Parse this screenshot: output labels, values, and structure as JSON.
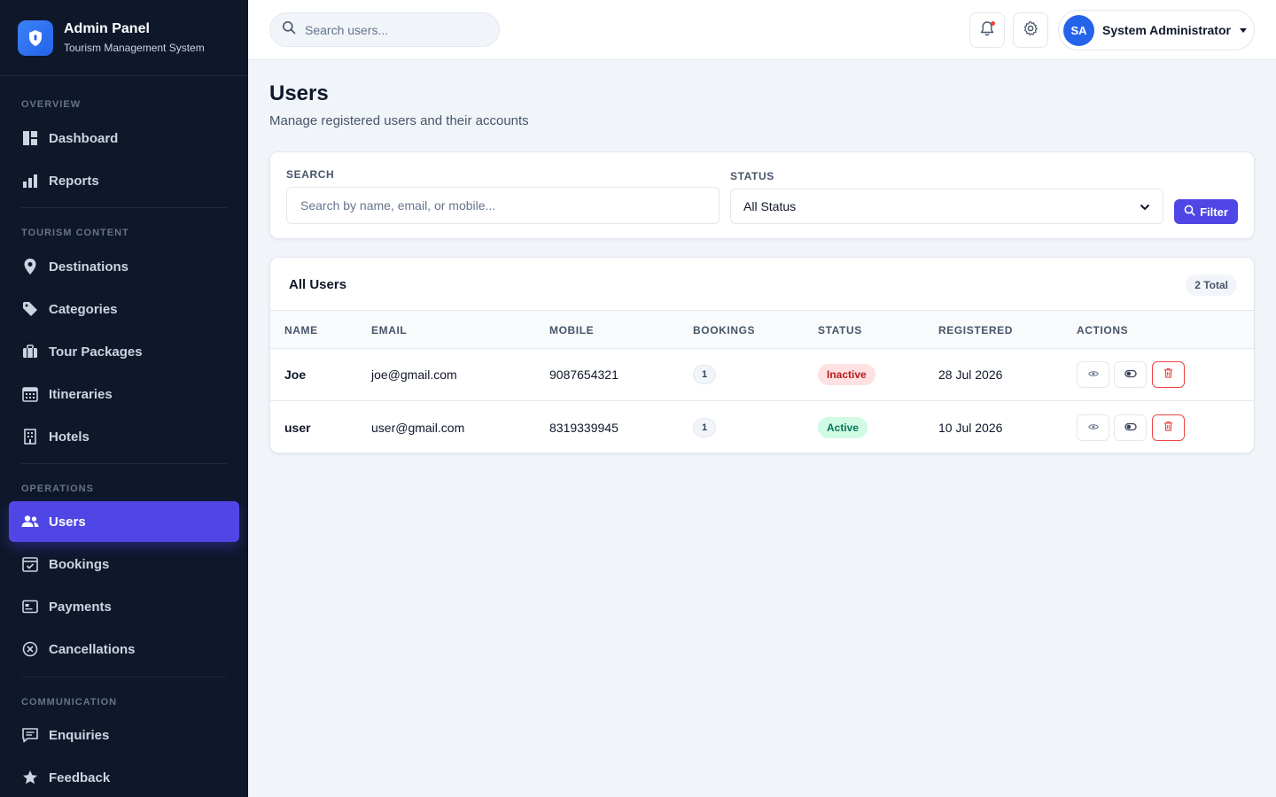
{
  "brand": {
    "title": "Admin Panel",
    "subtitle": "Tourism Management System"
  },
  "sidebar": {
    "sections": [
      {
        "heading": "OVERVIEW"
      },
      {
        "heading": "TOURISM CONTENT"
      },
      {
        "heading": "OPERATIONS"
      },
      {
        "heading": "COMMUNICATION"
      }
    ],
    "items": [
      {
        "label": "Dashboard",
        "icon": "dashboard-icon"
      },
      {
        "label": "Reports",
        "icon": "bar-chart-icon"
      },
      {
        "label": "Destinations",
        "icon": "map-pin-icon"
      },
      {
        "label": "Categories",
        "icon": "tag-icon"
      },
      {
        "label": "Tour Packages",
        "icon": "suitcase-icon"
      },
      {
        "label": "Itineraries",
        "icon": "calendar-grid-icon"
      },
      {
        "label": "Hotels",
        "icon": "building-icon"
      },
      {
        "label": "Users",
        "icon": "users-icon",
        "active": true
      },
      {
        "label": "Bookings",
        "icon": "calendar-check-icon"
      },
      {
        "label": "Payments",
        "icon": "credit-card-icon"
      },
      {
        "label": "Cancellations",
        "icon": "x-circle-icon"
      },
      {
        "label": "Enquiries",
        "icon": "message-icon"
      },
      {
        "label": "Feedback",
        "icon": "star-icon"
      }
    ]
  },
  "topbar": {
    "search_placeholder": "Search users...",
    "user": {
      "initials": "SA",
      "name": "System Administrator"
    }
  },
  "page": {
    "title": "Users",
    "subtitle": "Manage registered users and their accounts"
  },
  "filters": {
    "search_label": "SEARCH",
    "search_placeholder": "Search by name, email, or mobile...",
    "status_label": "STATUS",
    "status_value": "All Status",
    "filter_button": "Filter"
  },
  "users": {
    "title": "All Users",
    "total": "2 Total",
    "columns": [
      "NAME",
      "EMAIL",
      "MOBILE",
      "BOOKINGS",
      "STATUS",
      "REGISTERED",
      "ACTIONS"
    ],
    "rows": [
      {
        "name": "Joe",
        "email": "joe@gmail.com",
        "mobile": "9087654321",
        "bookings": "1",
        "status": "Inactive",
        "registered": "28 Jul 2026"
      },
      {
        "name": "user",
        "email": "user@gmail.com",
        "mobile": "8319339945",
        "bookings": "1",
        "status": "Active",
        "registered": "10 Jul 2026"
      }
    ]
  },
  "colors": {
    "accent": "#4f46e5",
    "sidebar_bg": "#0f172a",
    "active_status": "#047857",
    "inactive_status": "#b91c1c",
    "danger": "#ef4444"
  }
}
